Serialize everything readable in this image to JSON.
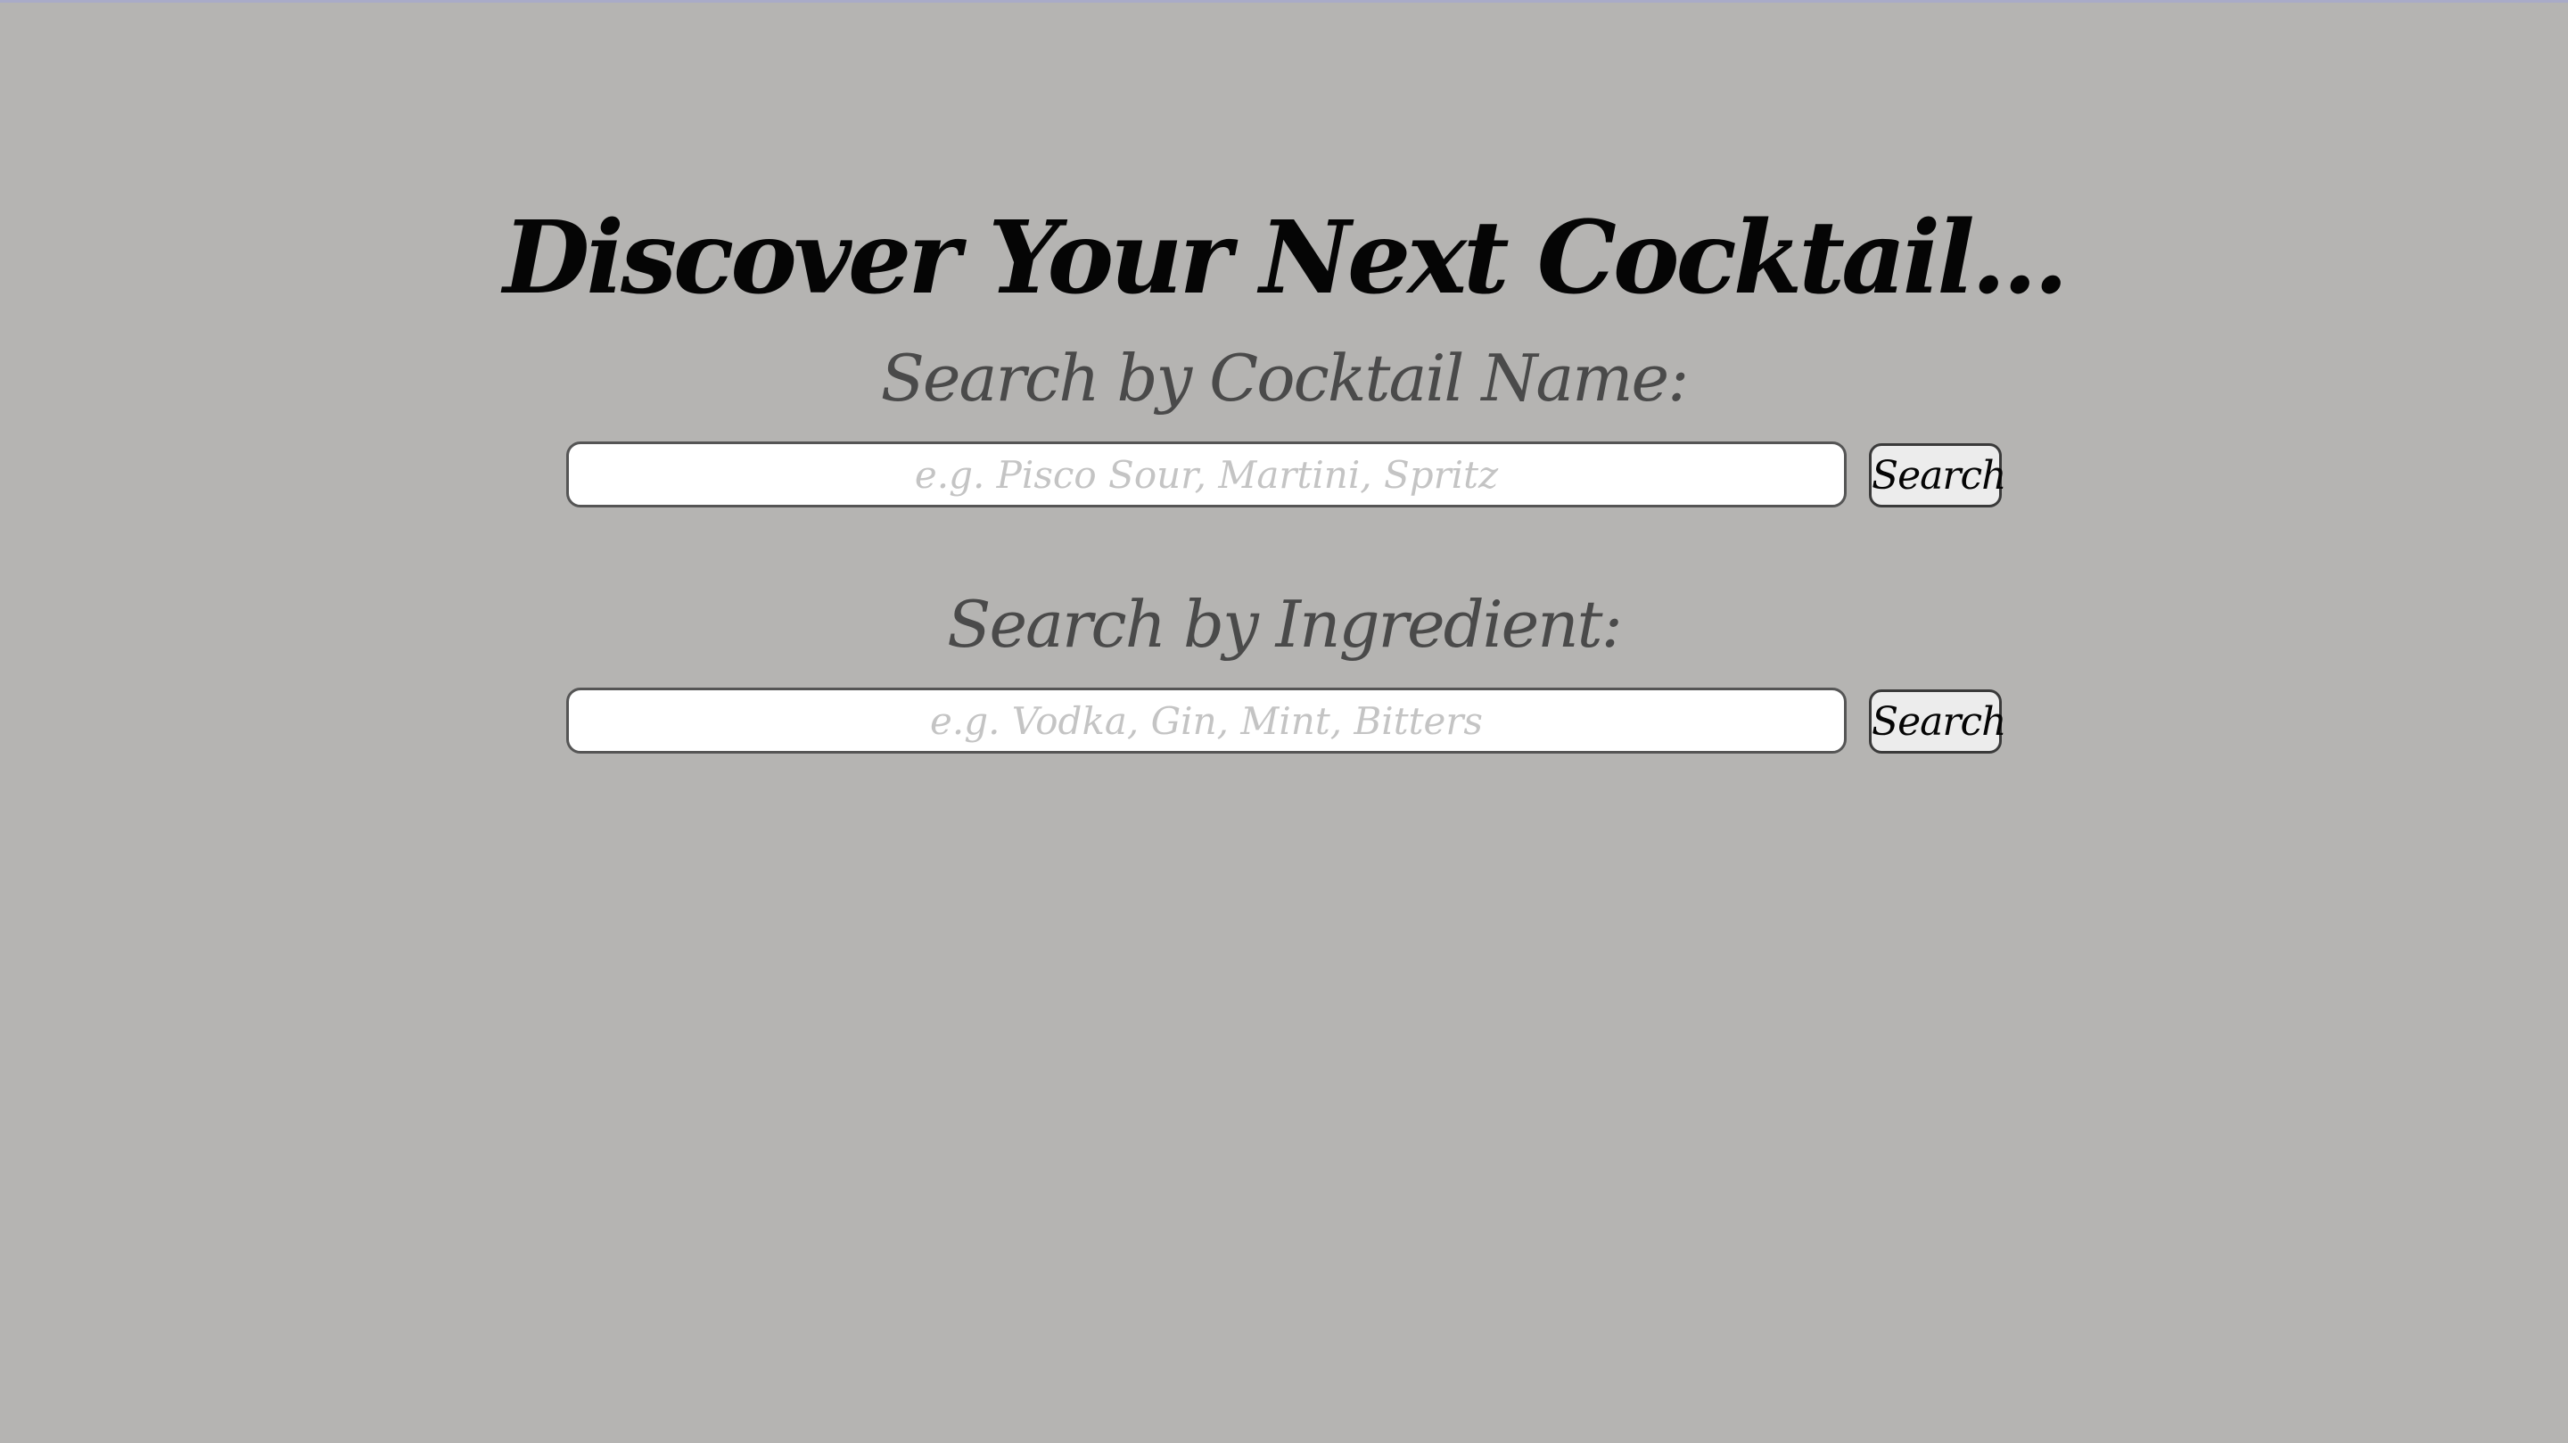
{
  "page": {
    "title": "Discover Your Next Cocktail..."
  },
  "name_search": {
    "label": "Search by Cocktail Name:",
    "placeholder": "e.g. Pisco Sour, Martini, Spritz",
    "value": "",
    "button_label": "Search"
  },
  "ingredient_search": {
    "label": "Search by Ingredient:",
    "placeholder": "e.g. Vodka, Gin, Mint, Bitters",
    "value": "",
    "button_label": "Search"
  },
  "colors": {
    "background": "#b5b4b2",
    "title": "#050505",
    "section_label": "#4a4a4a",
    "placeholder": "#c4c4c4",
    "button_background": "#ececec"
  }
}
